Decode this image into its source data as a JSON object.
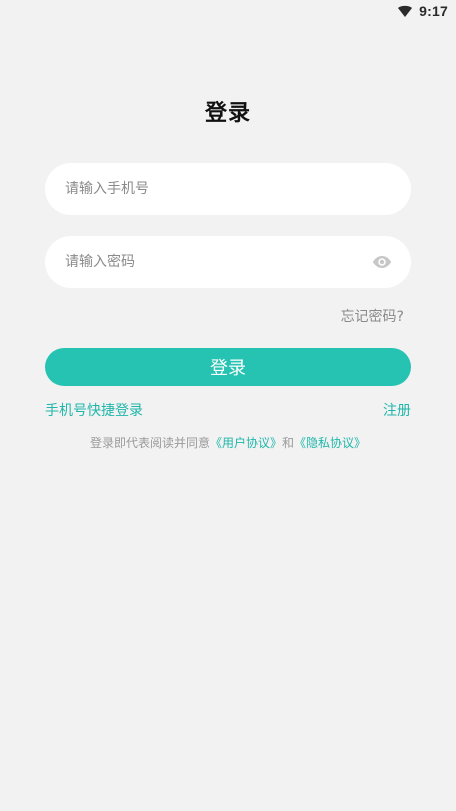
{
  "status_bar": {
    "time": "9:17",
    "wifi_icon": "wifi-icon"
  },
  "page": {
    "title": "登录"
  },
  "form": {
    "phone_placeholder": "请输入手机号",
    "password_placeholder": "请输入密码",
    "eye_icon": "eye-icon",
    "forgot_password": "忘记密码?",
    "login_button": "登录"
  },
  "links": {
    "sms_login": "手机号快捷登录",
    "register": "注册"
  },
  "agreement": {
    "prefix": "登录即代表阅读并同意",
    "user_agreement": "《用户协议》",
    "conjunction": "和",
    "privacy_agreement": "《隐私协议》"
  },
  "colors": {
    "accent": "#26c3b2",
    "link": "#20b7aa",
    "background": "#f2f2f2",
    "placeholder": "#8a8a8a"
  }
}
